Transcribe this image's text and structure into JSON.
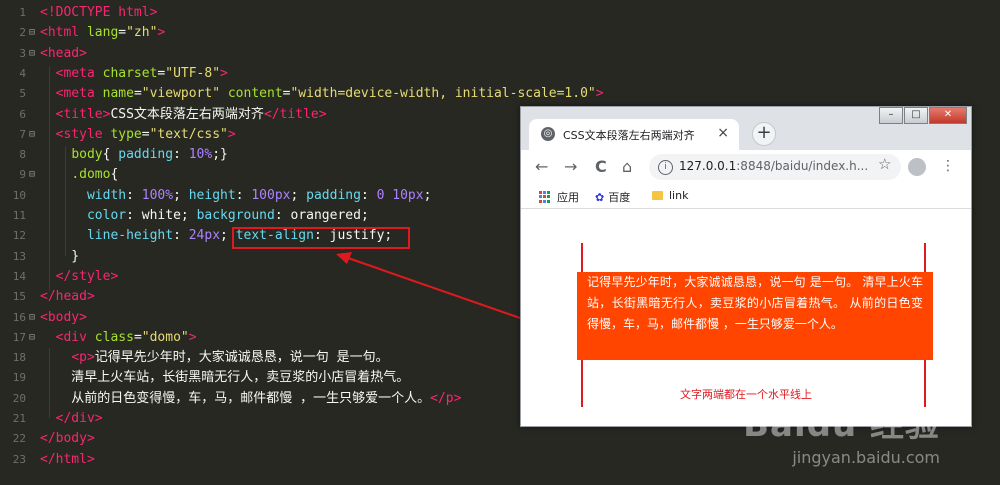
{
  "editor": {
    "lines": [
      {
        "n": "1",
        "fold": "",
        "parts": [
          [
            "tag",
            "<!DOCTYPE html>"
          ]
        ]
      },
      {
        "n": "2",
        "fold": "⊟",
        "parts": [
          [
            "tag",
            "<html "
          ],
          [
            "attr",
            "lang"
          ],
          [
            "txt",
            "="
          ],
          [
            "str",
            "\"zh\""
          ],
          [
            "tag",
            ">"
          ]
        ]
      },
      {
        "n": "3",
        "fold": "⊟",
        "parts": [
          [
            "tag",
            "<head>"
          ]
        ]
      },
      {
        "n": "4",
        "fold": "",
        "parts": [
          [
            "txt",
            "  "
          ],
          [
            "tag",
            "<meta "
          ],
          [
            "attr",
            "charset"
          ],
          [
            "txt",
            "="
          ],
          [
            "str",
            "\"UTF-8\""
          ],
          [
            "tag",
            ">"
          ]
        ]
      },
      {
        "n": "5",
        "fold": "",
        "parts": [
          [
            "txt",
            "  "
          ],
          [
            "tag",
            "<meta "
          ],
          [
            "attr",
            "name"
          ],
          [
            "txt",
            "="
          ],
          [
            "str",
            "\"viewport\" "
          ],
          [
            "attr",
            "content"
          ],
          [
            "txt",
            "="
          ],
          [
            "str",
            "\"width=device-width, initial-scale=1.0\""
          ],
          [
            "tag",
            ">"
          ]
        ]
      },
      {
        "n": "6",
        "fold": "",
        "parts": [
          [
            "txt",
            "  "
          ],
          [
            "tag",
            "<title>"
          ],
          [
            "txt",
            "CSS文本段落左右两端对齐"
          ],
          [
            "tag",
            "</title>"
          ]
        ]
      },
      {
        "n": "7",
        "fold": "⊟",
        "parts": [
          [
            "txt",
            "  "
          ],
          [
            "tag",
            "<style "
          ],
          [
            "attr",
            "type"
          ],
          [
            "txt",
            "="
          ],
          [
            "str",
            "\"text/css\""
          ],
          [
            "tag",
            ">"
          ]
        ]
      },
      {
        "n": "8",
        "fold": "",
        "parts": [
          [
            "txt",
            "    "
          ],
          [
            "sel",
            "body"
          ],
          [
            "txt",
            "{ "
          ],
          [
            "prop",
            "padding"
          ],
          [
            "txt",
            ": "
          ],
          [
            "num",
            "10%"
          ],
          [
            "txt",
            ";}"
          ]
        ]
      },
      {
        "n": "9",
        "fold": "⊟",
        "parts": [
          [
            "txt",
            "    "
          ],
          [
            "sel",
            ".domo"
          ],
          [
            "txt",
            "{"
          ]
        ]
      },
      {
        "n": "10",
        "fold": "",
        "parts": [
          [
            "txt",
            "      "
          ],
          [
            "prop",
            "width"
          ],
          [
            "txt",
            ": "
          ],
          [
            "num",
            "100%"
          ],
          [
            "txt",
            "; "
          ],
          [
            "prop",
            "height"
          ],
          [
            "txt",
            ": "
          ],
          [
            "num",
            "100px"
          ],
          [
            "txt",
            "; "
          ],
          [
            "prop",
            "padding"
          ],
          [
            "txt",
            ": "
          ],
          [
            "num",
            "0 10px"
          ],
          [
            "txt",
            ";"
          ]
        ]
      },
      {
        "n": "11",
        "fold": "",
        "parts": [
          [
            "txt",
            "      "
          ],
          [
            "prop",
            "color"
          ],
          [
            "txt",
            ": "
          ],
          [
            "val",
            "white"
          ],
          [
            "txt",
            "; "
          ],
          [
            "prop",
            "background"
          ],
          [
            "txt",
            ": "
          ],
          [
            "val",
            "orangered"
          ],
          [
            "txt",
            ";"
          ]
        ]
      },
      {
        "n": "12",
        "fold": "",
        "parts": [
          [
            "txt",
            "      "
          ],
          [
            "prop",
            "line-height"
          ],
          [
            "txt",
            ": "
          ],
          [
            "num",
            "24px"
          ],
          [
            "txt",
            "; "
          ],
          [
            "prop",
            "text-align"
          ],
          [
            "txt",
            ": "
          ],
          [
            "val",
            "justify"
          ],
          [
            "txt",
            ";"
          ]
        ]
      },
      {
        "n": "13",
        "fold": "",
        "parts": [
          [
            "txt",
            "    }"
          ]
        ]
      },
      {
        "n": "14",
        "fold": "",
        "parts": [
          [
            "txt",
            "  "
          ],
          [
            "tag",
            "</style>"
          ]
        ]
      },
      {
        "n": "15",
        "fold": "",
        "parts": [
          [
            "tag",
            "</head>"
          ]
        ]
      },
      {
        "n": "16",
        "fold": "⊟",
        "parts": [
          [
            "tag",
            "<body>"
          ]
        ]
      },
      {
        "n": "17",
        "fold": "⊟",
        "parts": [
          [
            "txt",
            "  "
          ],
          [
            "tag",
            "<div "
          ],
          [
            "attr",
            "class"
          ],
          [
            "txt",
            "="
          ],
          [
            "str",
            "\"domo\""
          ],
          [
            "tag",
            ">"
          ]
        ]
      },
      {
        "n": "18",
        "fold": "",
        "parts": [
          [
            "txt",
            "    "
          ],
          [
            "tag",
            "<p>"
          ],
          [
            "txt",
            "记得早先少年时，大家诚诚恳恳，说一句 是一句。"
          ]
        ]
      },
      {
        "n": "19",
        "fold": "",
        "parts": [
          [
            "txt",
            "    清早上火车站，长街黑暗无行人，卖豆浆的小店冒着热气。"
          ]
        ]
      },
      {
        "n": "20",
        "fold": "",
        "parts": [
          [
            "txt",
            "    从前的日色变得慢，车，马，邮件都慢 ，一生只够爱一个人。"
          ],
          [
            "tag",
            "</p>"
          ]
        ]
      },
      {
        "n": "21",
        "fold": "",
        "parts": [
          [
            "txt",
            "  "
          ],
          [
            "tag",
            "</div>"
          ]
        ]
      },
      {
        "n": "22",
        "fold": "",
        "parts": [
          [
            "tag",
            "</body>"
          ]
        ]
      },
      {
        "n": "23",
        "fold": "",
        "parts": [
          [
            "tag",
            "</html>"
          ]
        ]
      }
    ]
  },
  "browser": {
    "tab_title": "CSS文本段落左右两端对齐",
    "tab_close": "×",
    "new_tab": "+",
    "back": "←",
    "forward": "→",
    "reload": "C",
    "home": "⌂",
    "url_host": "127.0.0.1",
    "url_rest": ":8848/baidu/index.h...",
    "star": "☆",
    "menu": "⋮",
    "bookmarks": [
      "应用",
      "百度",
      "link"
    ],
    "paragraph": "记得早先少年时，大家诚诚恳恳，说一句 是一句。 清早上火车站，长街黑暗无行人，卖豆浆的小店冒着热气。 从前的日色变得慢，车，马，邮件都慢 ，一生只够爱一个人。",
    "note": "文字两端都在一个水平线上"
  },
  "watermark": {
    "logo": "Baidu 经验",
    "site": "jingyan.baidu.com"
  },
  "colors": {
    "editor_bg": "#272822",
    "highlight": "#e0191f",
    "domo_bg": "#ff4500"
  }
}
